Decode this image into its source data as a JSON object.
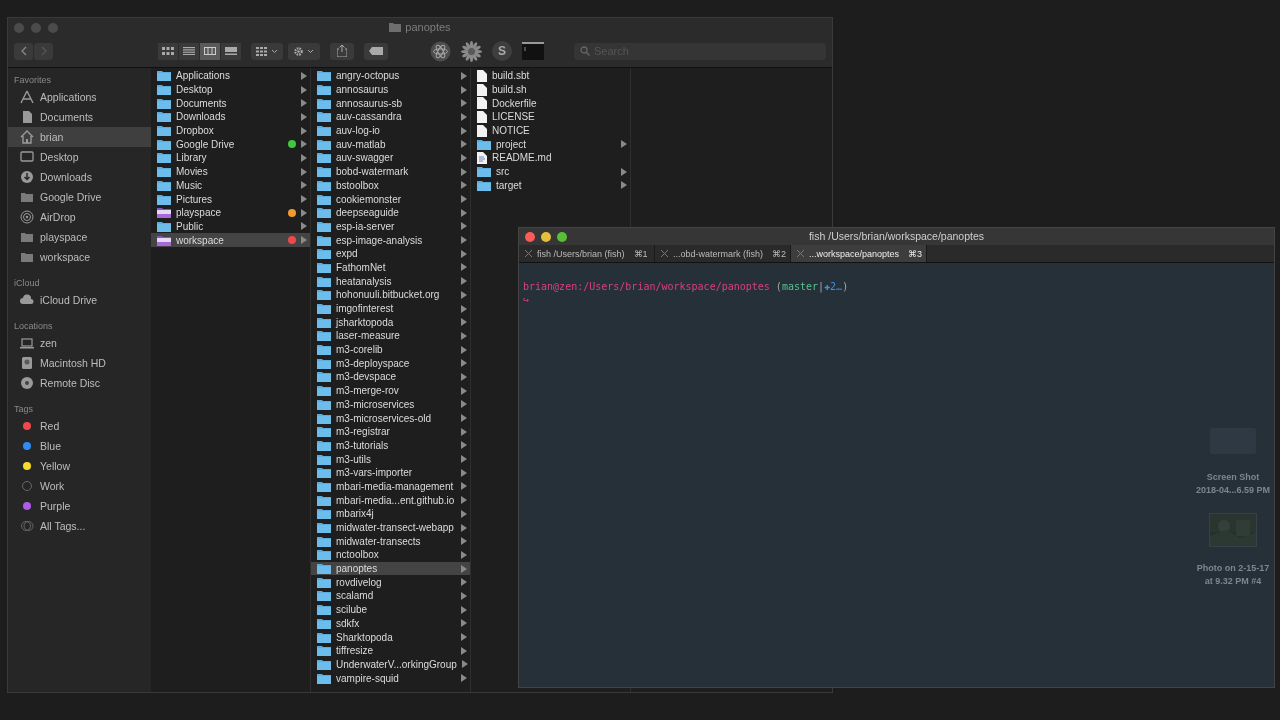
{
  "finder": {
    "title": "panoptes",
    "search": {
      "placeholder": "Search"
    },
    "toolbar": {
      "view_modes": [
        {
          "kind": "icons",
          "selected": false
        },
        {
          "kind": "list",
          "selected": false
        },
        {
          "kind": "columns",
          "selected": true
        },
        {
          "kind": "gallery",
          "selected": false
        }
      ],
      "apps": [
        {
          "kind": "atom"
        },
        {
          "kind": "flower"
        },
        {
          "kind": "letter",
          "label": "S"
        },
        {
          "kind": "terminal"
        }
      ]
    },
    "sidebar": [
      {
        "heading": "Favorites",
        "items": [
          {
            "label": "Applications",
            "kind": "apps",
            "selected": false
          },
          {
            "label": "Documents",
            "kind": "documents",
            "selected": false
          },
          {
            "label": "brian",
            "kind": "home",
            "selected": true
          },
          {
            "label": "Desktop",
            "kind": "desktop",
            "selected": false
          },
          {
            "label": "Downloads",
            "kind": "downloads",
            "selected": false
          },
          {
            "label": "Google Drive",
            "kind": "folder",
            "selected": false
          },
          {
            "label": "AirDrop",
            "kind": "airdrop",
            "selected": false
          },
          {
            "label": "playspace",
            "kind": "folder",
            "selected": false
          },
          {
            "label": "workspace",
            "kind": "folder",
            "selected": false
          }
        ]
      },
      {
        "heading": "iCloud",
        "items": [
          {
            "label": "iCloud Drive",
            "kind": "cloud",
            "selected": false
          }
        ]
      },
      {
        "heading": "Locations",
        "items": [
          {
            "label": "zen",
            "kind": "laptop",
            "selected": false
          },
          {
            "label": "Macintosh HD",
            "kind": "disk",
            "selected": false
          },
          {
            "label": "Remote Disc",
            "kind": "disc",
            "selected": false
          }
        ]
      },
      {
        "heading": "Tags",
        "items": [
          {
            "label": "Red",
            "kind": "tag",
            "color": "#f0474b",
            "selected": false
          },
          {
            "label": "Blue",
            "kind": "tag",
            "color": "#2f8cf5",
            "selected": false
          },
          {
            "label": "Yellow",
            "kind": "tag",
            "color": "#f5dc2b",
            "selected": false
          },
          {
            "label": "Work",
            "kind": "empty-tag",
            "selected": false
          },
          {
            "label": "Purple",
            "kind": "tag",
            "color": "#b25ae8",
            "selected": false
          },
          {
            "label": "All Tags...",
            "kind": "all-tags",
            "selected": false
          }
        ]
      }
    ],
    "columns": [
      {
        "items": [
          {
            "label": "Applications",
            "kind": "folder",
            "selected": false,
            "has_children": true
          },
          {
            "label": "Desktop",
            "kind": "folder",
            "selected": false,
            "has_children": true
          },
          {
            "label": "Documents",
            "kind": "folder",
            "selected": false,
            "has_children": true
          },
          {
            "label": "Downloads",
            "kind": "folder",
            "selected": false,
            "has_children": true
          },
          {
            "label": "Dropbox",
            "kind": "folder",
            "selected": false,
            "has_children": true
          },
          {
            "label": "Google Drive",
            "kind": "folder",
            "selected": false,
            "has_children": true,
            "color": "#3fc93f"
          },
          {
            "label": "Library",
            "kind": "folder",
            "selected": false,
            "has_children": true
          },
          {
            "label": "Movies",
            "kind": "folder",
            "selected": false,
            "has_children": true
          },
          {
            "label": "Music",
            "kind": "folder",
            "selected": false,
            "has_children": true
          },
          {
            "label": "Pictures",
            "kind": "folder",
            "selected": false,
            "has_children": true
          },
          {
            "label": "playspace",
            "kind": "purple-folder",
            "selected": false,
            "has_children": true,
            "color": "#f39a2c"
          },
          {
            "label": "Public",
            "kind": "folder",
            "selected": false,
            "has_children": true
          },
          {
            "label": "workspace",
            "kind": "purple-folder",
            "selected": true,
            "has_children": true,
            "color": "#f0474b"
          }
        ]
      },
      {
        "items": [
          {
            "label": "angry-octopus",
            "kind": "folder",
            "selected": false,
            "has_children": true
          },
          {
            "label": "annosaurus",
            "kind": "folder",
            "selected": false,
            "has_children": true
          },
          {
            "label": "annosaurus-sb",
            "kind": "folder",
            "selected": false,
            "has_children": true
          },
          {
            "label": "auv-cassandra",
            "kind": "folder",
            "selected": false,
            "has_children": true
          },
          {
            "label": "auv-log-io",
            "kind": "folder",
            "selected": false,
            "has_children": true
          },
          {
            "label": "auv-matlab",
            "kind": "folder",
            "selected": false,
            "has_children": true
          },
          {
            "label": "auv-swagger",
            "kind": "folder",
            "selected": false,
            "has_children": true
          },
          {
            "label": "bobd-watermark",
            "kind": "folder",
            "selected": false,
            "has_children": true
          },
          {
            "label": "bstoolbox",
            "kind": "folder",
            "selected": false,
            "has_children": true
          },
          {
            "label": "cookiemonster",
            "kind": "folder",
            "selected": false,
            "has_children": true
          },
          {
            "label": "deepseaguide",
            "kind": "folder",
            "selected": false,
            "has_children": true
          },
          {
            "label": "esp-ia-server",
            "kind": "folder",
            "selected": false,
            "has_children": true
          },
          {
            "label": "esp-image-analysis",
            "kind": "folder",
            "selected": false,
            "has_children": true
          },
          {
            "label": "expd",
            "kind": "folder",
            "selected": false,
            "has_children": true
          },
          {
            "label": "FathomNet",
            "kind": "folder",
            "selected": false,
            "has_children": true
          },
          {
            "label": "heatanalysis",
            "kind": "folder",
            "selected": false,
            "has_children": true
          },
          {
            "label": "hohonuuli.bitbucket.org",
            "kind": "folder",
            "selected": false,
            "has_children": true
          },
          {
            "label": "imgofinterest",
            "kind": "folder",
            "selected": false,
            "has_children": true
          },
          {
            "label": "jsharktopoda",
            "kind": "folder",
            "selected": false,
            "has_children": true
          },
          {
            "label": "laser-measure",
            "kind": "folder",
            "selected": false,
            "has_children": true
          },
          {
            "label": "m3-corelib",
            "kind": "folder",
            "selected": false,
            "has_children": true
          },
          {
            "label": "m3-deployspace",
            "kind": "folder",
            "selected": false,
            "has_children": true
          },
          {
            "label": "m3-devspace",
            "kind": "folder",
            "selected": false,
            "has_children": true
          },
          {
            "label": "m3-merge-rov",
            "kind": "folder",
            "selected": false,
            "has_children": true
          },
          {
            "label": "m3-microservices",
            "kind": "folder",
            "selected": false,
            "has_children": true
          },
          {
            "label": "m3-microservices-old",
            "kind": "folder",
            "selected": false,
            "has_children": true
          },
          {
            "label": "m3-registrar",
            "kind": "folder",
            "selected": false,
            "has_children": true
          },
          {
            "label": "m3-tutorials",
            "kind": "folder",
            "selected": false,
            "has_children": true
          },
          {
            "label": "m3-utils",
            "kind": "folder",
            "selected": false,
            "has_children": true
          },
          {
            "label": "m3-vars-importer",
            "kind": "folder",
            "selected": false,
            "has_children": true
          },
          {
            "label": "mbari-media-management",
            "kind": "folder",
            "selected": false,
            "has_children": true
          },
          {
            "label": "mbari-media...ent.github.io",
            "kind": "folder",
            "selected": false,
            "has_children": true
          },
          {
            "label": "mbarix4j",
            "kind": "folder",
            "selected": false,
            "has_children": true
          },
          {
            "label": "midwater-transect-webapp",
            "kind": "folder",
            "selected": false,
            "has_children": true
          },
          {
            "label": "midwater-transects",
            "kind": "folder",
            "selected": false,
            "has_children": true
          },
          {
            "label": "nctoolbox",
            "kind": "folder",
            "selected": false,
            "has_children": true
          },
          {
            "label": "panoptes",
            "kind": "folder",
            "selected": true,
            "has_children": true
          },
          {
            "label": "rovdivelog",
            "kind": "folder",
            "selected": false,
            "has_children": true
          },
          {
            "label": "scalamd",
            "kind": "folder",
            "selected": false,
            "has_children": true
          },
          {
            "label": "scilube",
            "kind": "folder",
            "selected": false,
            "has_children": true
          },
          {
            "label": "sdkfx",
            "kind": "folder",
            "selected": false,
            "has_children": true
          },
          {
            "label": "Sharktopoda",
            "kind": "folder",
            "selected": false,
            "has_children": true
          },
          {
            "label": "tiffresize",
            "kind": "folder",
            "selected": false,
            "has_children": true
          },
          {
            "label": "UnderwaterV...orkingGroup",
            "kind": "folder",
            "selected": false,
            "has_children": true
          },
          {
            "label": "vampire-squid",
            "kind": "folder",
            "selected": false,
            "has_children": true
          }
        ]
      },
      {
        "items": [
          {
            "label": "build.sbt",
            "kind": "file",
            "selected": false,
            "has_children": false
          },
          {
            "label": "build.sh",
            "kind": "file",
            "selected": false,
            "has_children": false
          },
          {
            "label": "Dockerfile",
            "kind": "file",
            "selected": false,
            "has_children": false
          },
          {
            "label": "LICENSE",
            "kind": "file",
            "selected": false,
            "has_children": false
          },
          {
            "label": "NOTICE",
            "kind": "file",
            "selected": false,
            "has_children": false
          },
          {
            "label": "project",
            "kind": "folder",
            "selected": false,
            "has_children": true
          },
          {
            "label": "README.md",
            "kind": "document",
            "selected": false,
            "has_children": false
          },
          {
            "label": "src",
            "kind": "folder",
            "selected": false,
            "has_children": true
          },
          {
            "label": "target",
            "kind": "folder",
            "selected": false,
            "has_children": true
          }
        ]
      }
    ]
  },
  "desktop_items": [
    {
      "kind": "screenshot",
      "lines": [
        "Screen Shot",
        "2018-04...6.59 PM"
      ]
    },
    {
      "kind": "picture",
      "lines": [
        "Photo on 2-15-17",
        "at 9.32 PM #4"
      ]
    }
  ],
  "terminal": {
    "title": "fish  /Users/brian/workspace/panoptes",
    "tabs": [
      {
        "label": "fish  /Users/brian (fish)",
        "shortcut": "⌘1",
        "selected": false
      },
      {
        "label": "...obd-watermark (fish)",
        "shortcut": "⌘2",
        "selected": false
      },
      {
        "label": "...workspace/panoptes",
        "shortcut": "⌘3",
        "selected": true
      }
    ],
    "prompt": {
      "path": "brian@zen:/Users/brian/workspace/panoptes",
      "open": "(",
      "branch": "master",
      "separator": "|",
      "status_mark": "✚",
      "status": "2…",
      "close": ")",
      "cursor_line": "↪"
    }
  }
}
